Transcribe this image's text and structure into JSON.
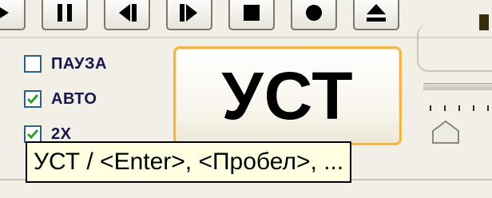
{
  "toolbar": {
    "buttons": [
      {
        "icon": "play-icon"
      },
      {
        "icon": "pause-icon"
      },
      {
        "icon": "step-back-icon"
      },
      {
        "icon": "step-forward-icon"
      },
      {
        "icon": "stop-icon"
      },
      {
        "icon": "record-icon"
      },
      {
        "icon": "eject-icon"
      }
    ]
  },
  "options": {
    "pause": {
      "label": "ПАУЗА",
      "checked": false
    },
    "auto": {
      "label": "АВТО",
      "checked": true
    },
    "double": {
      "label": "2X",
      "checked": true
    }
  },
  "main_button": {
    "label": "УСТ"
  },
  "tooltip": {
    "text": "УСТ / <Enter>, <Пробел>, ..."
  },
  "colors": {
    "accent_border": "#f0b64a",
    "check_green": "#2aa02a",
    "checkbox_border": "#2d5f8a",
    "tooltip_bg": "#ffffe1",
    "label_color": "#17164d"
  }
}
